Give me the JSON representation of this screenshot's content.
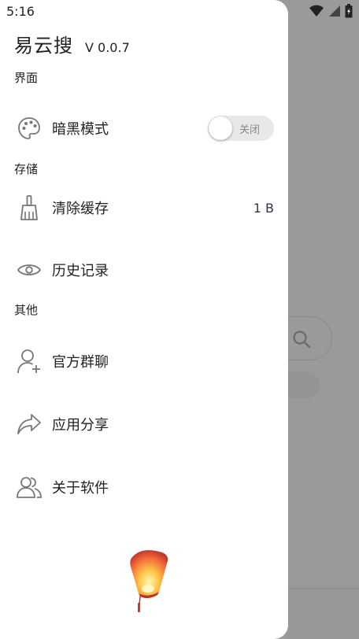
{
  "status_bar": {
    "time": "5:16"
  },
  "drawer": {
    "app_title": "易云搜",
    "app_version": "V 0.0.7",
    "sections": {
      "interface": "界面",
      "storage": "存储",
      "other": "其他"
    },
    "items": {
      "dark_mode": {
        "label": "暗黑模式",
        "icon": "palette-icon",
        "toggle_text": "关闭",
        "toggle_on": false
      },
      "clear_cache": {
        "label": "清除缓存",
        "icon": "broom-icon",
        "value": "1 B"
      },
      "history": {
        "label": "历史记录",
        "icon": "eye-icon"
      },
      "group_chat": {
        "label": "官方群聊",
        "icon": "add-user-icon"
      },
      "share_app": {
        "label": "应用分享",
        "icon": "share-icon"
      },
      "about": {
        "label": "关于软件",
        "icon": "users-icon"
      }
    }
  },
  "colors": {
    "scrim": "#9a9a9a",
    "drawer_bg": "#ffffff",
    "text": "#222222",
    "icon": "#777777"
  }
}
